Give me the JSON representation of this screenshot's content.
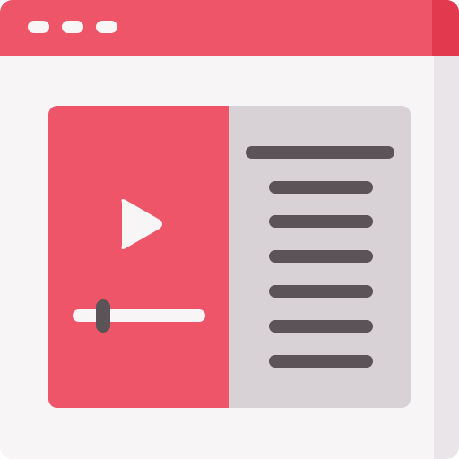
{
  "window": {
    "title": "",
    "controls": [
      "window-dot",
      "window-dot",
      "window-dot"
    ]
  },
  "player": {
    "play_icon": "play-icon",
    "progress": 0.22
  },
  "playlist": {
    "header_text": "",
    "items": [
      "",
      "",
      "",
      "",
      "",
      ""
    ]
  },
  "colors": {
    "accent": "#ee5569",
    "accent_dark": "#e3394f",
    "background": "#f7f5f6",
    "panel": "#d8d2d7",
    "text_lines": "#5b5357"
  }
}
